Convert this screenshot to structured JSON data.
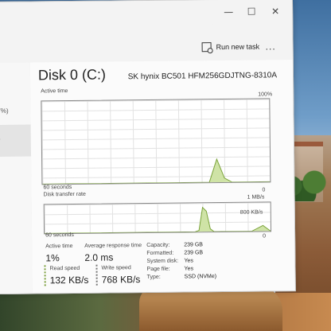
{
  "window": {
    "minimize_glyph": "—",
    "maximize_glyph": "☐",
    "close_glyph": "✕"
  },
  "toolbar": {
    "run_new_task_label": "Run new task",
    "more_glyph": "..."
  },
  "leftpane": {
    "partial_percent": "7%)",
    "partial_glyph": ")"
  },
  "disk": {
    "title": "Disk 0 (C:)",
    "model": "SK hynix BC501 HFM256GDJTNG-8310A",
    "active_time_label": "Active time",
    "active_time_max": "100%",
    "graph1_time_label": "60 seconds",
    "graph1_zero": "0",
    "transfer_rate_label": "Disk transfer rate",
    "transfer_rate_max": "1 MB/s",
    "transfer_rate_mid": "800 KB/s",
    "graph2_time_label": "60 seconds",
    "graph2_zero": "0"
  },
  "stats": {
    "active_time_label": "Active time",
    "active_time_value": "1%",
    "avg_response_label": "Average response time",
    "avg_response_value": "2.0 ms",
    "read_speed_label": "Read speed",
    "read_speed_value": "132 KB/s",
    "write_speed_label": "Write speed",
    "write_speed_value": "768 KB/s"
  },
  "properties": [
    {
      "key": "Capacity:",
      "value": "239 GB"
    },
    {
      "key": "Formatted:",
      "value": "239 GB"
    },
    {
      "key": "System disk:",
      "value": "Yes"
    },
    {
      "key": "Page file:",
      "value": "Yes"
    },
    {
      "key": "Type:",
      "value": "SSD (NVMe)"
    }
  ],
  "colors": {
    "graph_line": "#7aa33a",
    "graph_fill": "#cfe3a6",
    "graph_border": "#8b8b8b"
  },
  "chart_data": [
    {
      "type": "area",
      "title": "Active time",
      "ylim": [
        0,
        100
      ],
      "x": [
        0,
        5,
        10,
        15,
        20,
        25,
        30,
        35,
        40,
        44,
        46,
        48,
        50,
        55,
        60
      ],
      "values": [
        0,
        0,
        0,
        0,
        0,
        0,
        0,
        0,
        0,
        0,
        28,
        5,
        0,
        0,
        0
      ]
    },
    {
      "type": "area",
      "title": "Disk transfer rate",
      "ylim": [
        0,
        1000
      ],
      "x": [
        0,
        5,
        10,
        15,
        20,
        25,
        30,
        35,
        40,
        41,
        42,
        43,
        44,
        45,
        46,
        48,
        50,
        55,
        58,
        60
      ],
      "values": [
        0,
        0,
        0,
        0,
        0,
        0,
        0,
        0,
        0,
        50,
        850,
        720,
        100,
        0,
        0,
        0,
        0,
        0,
        200,
        0
      ]
    }
  ]
}
